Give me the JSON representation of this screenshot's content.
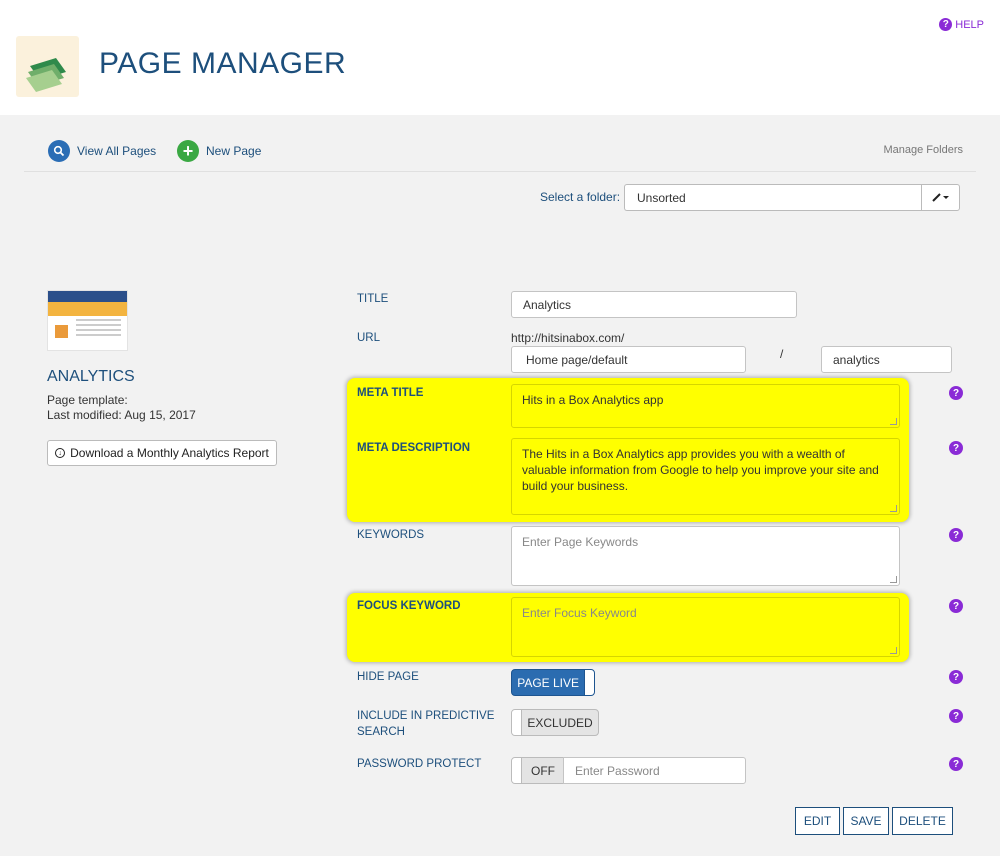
{
  "header": {
    "title": "PAGE MANAGER",
    "help_label": "HELP"
  },
  "nav": {
    "view_all_label": "View All Pages",
    "new_page_label": "New Page",
    "manage_folders_label": "Manage Folders"
  },
  "folder": {
    "label": "Select a folder:",
    "selected": "Unsorted"
  },
  "page_info": {
    "title": "ANALYTICS",
    "template_label": "Page template:",
    "last_modified": "Last modified: Aug 15, 2017",
    "download_label": "Download a Monthly Analytics Report"
  },
  "form": {
    "title_label": "TITLE",
    "title_value": "Analytics",
    "url_label": "URL",
    "url_prefix": "http://hitsinabox.com/",
    "url_parent": "Home page/default",
    "url_separator": "/",
    "url_slug": "analytics",
    "meta_title_label": "META TITLE",
    "meta_title_value": "Hits in a Box Analytics app",
    "meta_description_label": "META DESCRIPTION",
    "meta_description_value": "The Hits in a Box Analytics app provides you with a wealth of valuable information from Google to help you improve your site and build your business.",
    "keywords_label": "KEYWORDS",
    "keywords_placeholder": "Enter Page Keywords",
    "focus_keyword_label": "FOCUS KEYWORD",
    "focus_keyword_placeholder": "Enter Focus Keyword",
    "hide_page_label": "HIDE PAGE",
    "hide_page_state": "PAGE LIVE",
    "predictive_label": "INCLUDE IN PREDICTIVE SEARCH",
    "predictive_state": "EXCLUDED",
    "password_label": "PASSWORD PROTECT",
    "password_state": "OFF",
    "password_placeholder": "Enter Password"
  },
  "actions": {
    "edit": "EDIT",
    "save": "SAVE",
    "delete": "DELETE"
  },
  "colors": {
    "brand_blue": "#1d4f7c",
    "help_purple": "#8a2bd6",
    "highlight_yellow": "#ffff00",
    "toggle_blue": "#2b6cb0"
  }
}
